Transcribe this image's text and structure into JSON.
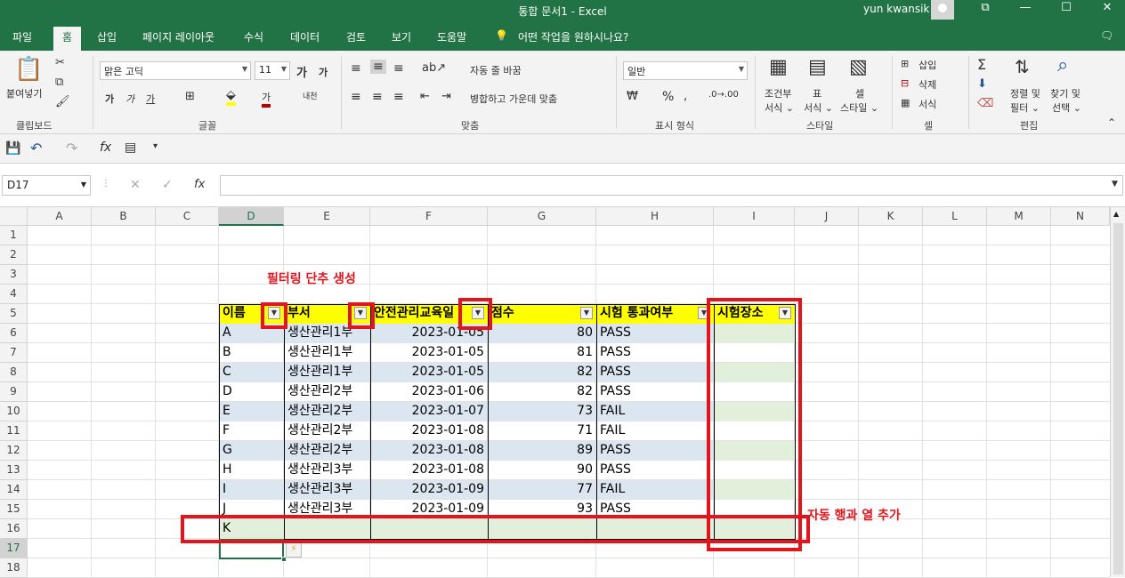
{
  "window": {
    "title": "통합 문서1  -  Excel",
    "user": "yun kwansik",
    "controls": [
      "⧉",
      "—",
      "☐",
      "✕"
    ]
  },
  "tabs": [
    "파일",
    "홈",
    "삽입",
    "페이지 레이아웃",
    "수식",
    "데이터",
    "검토",
    "보기",
    "도움말"
  ],
  "tell_me": "어떤 작업을 원하시나요?",
  "ribbon": {
    "clipboard": {
      "paste": "붙여넣기",
      "label": "클립보드"
    },
    "font": {
      "name": "맑은 고딕",
      "size": "11",
      "label": "글꼴",
      "bold": "가",
      "italic": "가",
      "underline": "가",
      "grow": "가",
      "shrink": "가",
      "font_color": "가",
      "phonetic": "내천"
    },
    "alignment": {
      "wrap": "자동 줄 바꿈",
      "merge": "병합하고 가운데 맞춤",
      "label": "맞춤"
    },
    "number": {
      "format": "일반",
      "label": "표시 형식",
      "percent": "%"
    },
    "styles": {
      "conditional": [
        "조건부",
        "서식 ⌄"
      ],
      "table": [
        "표",
        "서식 ⌄"
      ],
      "cell": [
        "셀",
        "스타일 ⌄"
      ],
      "label": "스타일"
    },
    "cells": {
      "insert": "삽입",
      "delete": "삭제",
      "format": "서식",
      "label": "셀"
    },
    "editing": {
      "sort": [
        "정렬 및",
        "필터 ⌄"
      ],
      "find": [
        "찾기 및",
        "선택 ⌄"
      ],
      "label": "편집"
    }
  },
  "formula_bar": {
    "name_box": "D17",
    "fx": "fx",
    "value": ""
  },
  "columns": [
    "A",
    "B",
    "C",
    "D",
    "E",
    "F",
    "G",
    "H",
    "I",
    "J",
    "K",
    "L",
    "M",
    "N"
  ],
  "rows": [
    "1",
    "2",
    "3",
    "4",
    "5",
    "6",
    "7",
    "8",
    "9",
    "10",
    "11",
    "12",
    "13",
    "14",
    "15",
    "16",
    "17",
    "18"
  ],
  "table": {
    "headers": [
      "이름",
      "부서",
      "안전관리교육일",
      "점수",
      "시험 통과여부",
      "시험장소"
    ],
    "rows": [
      [
        "A",
        "생산관리1부",
        "2023-01-05",
        "80",
        "PASS",
        ""
      ],
      [
        "B",
        "생산관리1부",
        "2023-01-05",
        "81",
        "PASS",
        ""
      ],
      [
        "C",
        "생산관리1부",
        "2023-01-05",
        "82",
        "PASS",
        ""
      ],
      [
        "D",
        "생산관리2부",
        "2023-01-06",
        "82",
        "PASS",
        ""
      ],
      [
        "E",
        "생산관리2부",
        "2023-01-07",
        "73",
        "FAIL",
        ""
      ],
      [
        "F",
        "생산관리2부",
        "2023-01-08",
        "71",
        "FAIL",
        ""
      ],
      [
        "G",
        "생산관리2부",
        "2023-01-08",
        "89",
        "PASS",
        ""
      ],
      [
        "H",
        "생산관리3부",
        "2023-01-08",
        "90",
        "PASS",
        ""
      ],
      [
        "I",
        "생산관리3부",
        "2023-01-09",
        "77",
        "FAIL",
        ""
      ],
      [
        "J",
        "생산관리3부",
        "2023-01-09",
        "93",
        "PASS",
        ""
      ],
      [
        "K",
        "",
        "",
        "",
        "",
        ""
      ]
    ]
  },
  "annotations": {
    "filter_note": "필터링 단추 생성",
    "auto_note": "자동 행과 열 추가"
  },
  "colors": {
    "excel_green": "#217346",
    "header_fill": "#ffff00",
    "band_blue": "#dce6f1",
    "band_green": "#e2efda",
    "annotation_red": "#e3141c"
  }
}
